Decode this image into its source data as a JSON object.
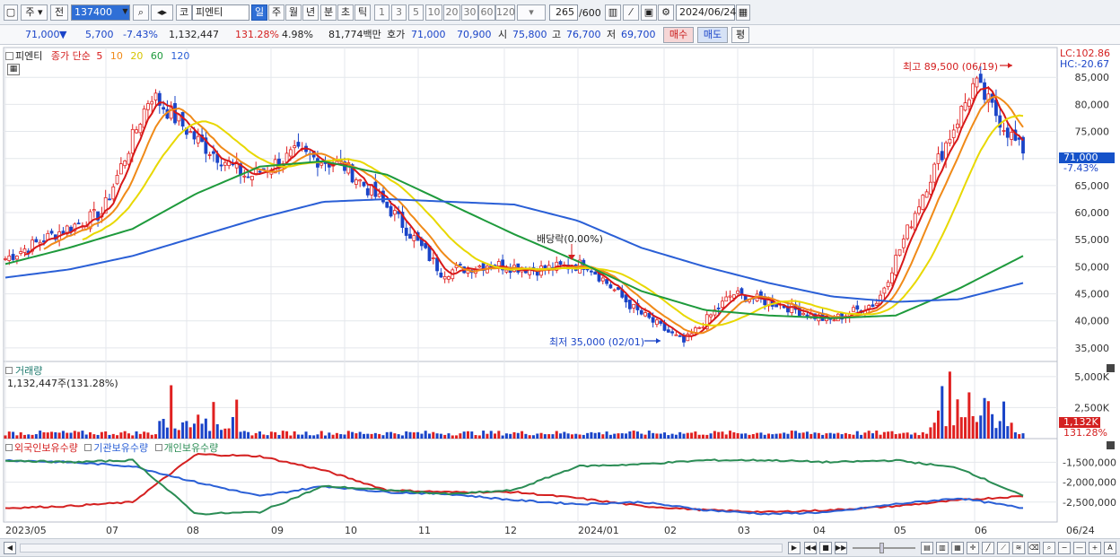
{
  "toolbar": {
    "period_label": "주",
    "prev_label": "전",
    "stock_code": "137400",
    "market_label": "코",
    "stock_name": "피엔티",
    "tabs": [
      "일",
      "주",
      "월",
      "년",
      "분",
      "초",
      "틱"
    ],
    "active_tab": "일",
    "numbers": [
      "1",
      "3",
      "5",
      "10",
      "20",
      "30",
      "60",
      "120"
    ],
    "count": "265",
    "count_total": "/600",
    "date": "2024/06/24"
  },
  "quote": {
    "price": "71,000",
    "change_arrow": "▼",
    "change": "5,700",
    "change_pct": "-7.43%",
    "volume": "1,132,447",
    "volume_ratio": "131.28%",
    "turnover": "4.98%",
    "trade_amount": "81,774백만",
    "bid_label": "호가",
    "bid1": "71,000",
    "bid2": "70,900",
    "open_label": "시",
    "open": "75,800",
    "high_label": "고",
    "high": "76,700",
    "low_label": "저",
    "low": "69,700",
    "buy_label": "매수",
    "sell_label": "매도",
    "eval_label": "평"
  },
  "price_legend": {
    "name": "피엔티",
    "type": "종가 단순",
    "ma": [
      {
        "label": "5",
        "color": "#d81818"
      },
      {
        "label": "10",
        "color": "#f08a18"
      },
      {
        "label": "20",
        "color": "#e8d800"
      },
      {
        "label": "60",
        "color": "#1e9a3c"
      },
      {
        "label": "120",
        "color": "#2a5fd6"
      }
    ],
    "lc": "LC:102.86",
    "hc": "HC:-20.67",
    "current_price_label": "71,000",
    "current_pct_label": "-7.43%"
  },
  "annotations": {
    "high": "최고 89,500 (06/19)",
    "low": "최저 35,000 (02/01)",
    "dividend": "배당락(0.00%)"
  },
  "volume_legend": {
    "title": "거래량",
    "value": "1,132,447주(131.28%)",
    "current_label": "1,132K",
    "current_pct": "131.28%"
  },
  "holdings_legend": {
    "foreign": "외국인보유수량",
    "institution": "기관보유수량",
    "individual": "개인보유수량"
  },
  "chart_data": [
    {
      "type": "candlestick",
      "title": "",
      "y_unit": "KRW",
      "yticks": [
        "85,000",
        "80,000",
        "75,000",
        "70,000",
        "65,000",
        "60,000",
        "55,000",
        "50,000",
        "45,000",
        "40,000",
        "35,000"
      ],
      "ylim": [
        32500,
        90500
      ],
      "x_labels": [
        "2023/05",
        "07",
        "08",
        "09",
        "10",
        "11",
        "12",
        "2024/01",
        "02",
        "03",
        "04",
        "05",
        "06",
        "06/24"
      ],
      "close_approx": [
        {
          "x": "2023/05",
          "y": 51500
        },
        {
          "x": "06",
          "y": 56000
        },
        {
          "x": "07",
          "y": 60000
        },
        {
          "x": "07 late",
          "y": 82000
        },
        {
          "x": "08",
          "y": 73000
        },
        {
          "x": "08 late",
          "y": 66500
        },
        {
          "x": "09",
          "y": 71000
        },
        {
          "x": "09 late",
          "y": 68500
        },
        {
          "x": "10",
          "y": 60000
        },
        {
          "x": "11",
          "y": 49000
        },
        {
          "x": "11 late",
          "y": 50500
        },
        {
          "x": "12",
          "y": 49500
        },
        {
          "x": "2024/01",
          "y": 50500
        },
        {
          "x": "01 late",
          "y": 42000
        },
        {
          "x": "02",
          "y": 36000
        },
        {
          "x": "03",
          "y": 45000
        },
        {
          "x": "03 late",
          "y": 43000
        },
        {
          "x": "04",
          "y": 40000
        },
        {
          "x": "05",
          "y": 43500
        },
        {
          "x": "06",
          "y": 65000
        },
        {
          "x": "06/19",
          "y": 84000
        },
        {
          "x": "06/24",
          "y": 71000
        }
      ],
      "series": [
        {
          "name": "5",
          "color": "#d81818"
        },
        {
          "name": "10",
          "color": "#f08a18"
        },
        {
          "name": "20",
          "color": "#e8d800"
        },
        {
          "name": "60",
          "color": "#1e9a3c",
          "values_approx": [
            50500,
            53500,
            57000,
            63500,
            68500,
            69500,
            67000,
            61500,
            56000,
            51000,
            45500,
            42000,
            41000,
            40500,
            41000,
            46000,
            52000
          ]
        },
        {
          "name": "120",
          "color": "#2a5fd6",
          "values_approx": [
            48000,
            49500,
            52000,
            55500,
            59000,
            62000,
            62500,
            62000,
            61500,
            58500,
            53500,
            50000,
            47000,
            44500,
            43500,
            44000,
            47000
          ]
        }
      ]
    },
    {
      "type": "bar",
      "title": "거래량",
      "yticks": [
        "5,000K",
        "2,500K"
      ],
      "ylim": [
        0,
        6000000
      ],
      "note": "daily volume, spikes in 2023/07 and 2024/06"
    },
    {
      "type": "line",
      "title": "보유수량",
      "yticks": [
        "-1,500,000",
        "-2,000,000",
        "-2,500,000"
      ],
      "ylim": [
        -3000000,
        -1200000
      ],
      "series": [
        {
          "name": "외국인보유수량",
          "color": "#d42020"
        },
        {
          "name": "기관보유수량",
          "color": "#2a5fd6"
        },
        {
          "name": "개인보유수량",
          "color": "#2a8c54"
        }
      ]
    }
  ]
}
